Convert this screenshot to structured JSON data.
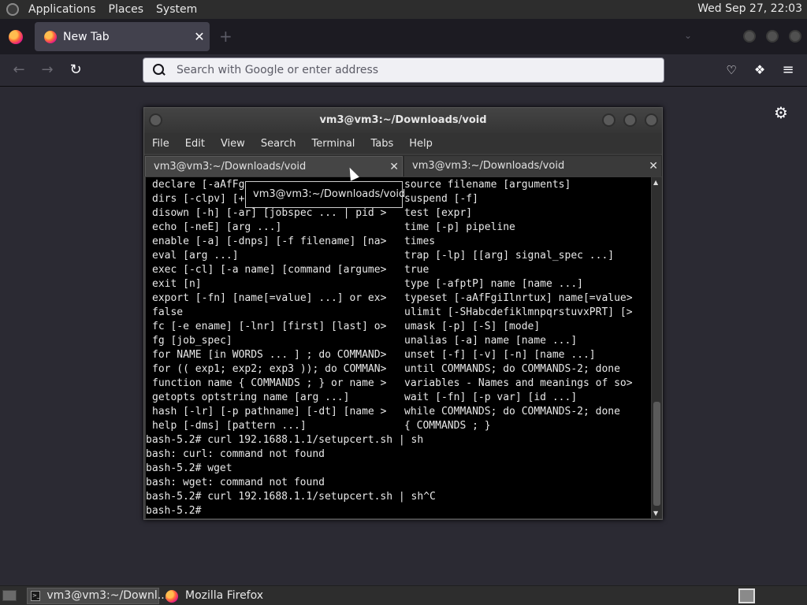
{
  "top_panel": {
    "menus": [
      "Applications",
      "Places",
      "System"
    ],
    "clock": "Wed Sep 27, 22:03"
  },
  "firefox": {
    "tab": {
      "label": "New Tab",
      "close": "✕"
    },
    "urlbar": {
      "placeholder": "Search with Google or enter address"
    }
  },
  "terminal": {
    "title": "vm3@vm3:~/Downloads/void",
    "menus": [
      "File",
      "Edit",
      "View",
      "Search",
      "Terminal",
      "Tabs",
      "Help"
    ],
    "tabs": [
      {
        "label": "vm3@vm3:~/Downloads/void",
        "close": "✕"
      },
      {
        "label": "vm3@vm3:~/Downloads/void",
        "close": "✕"
      }
    ],
    "tooltip": "vm3@vm3:~/Downloads/void",
    "lines": [
      {
        "left": "declare [-aAfFg",
        "right": "source filename [arguments]"
      },
      {
        "left": "dirs [-clpv] [+",
        "right": "suspend [-f]"
      },
      {
        "left": "disown [-h] [-ar] [jobspec ... | pid >",
        "right": "test [expr]"
      },
      {
        "left": "echo [-neE] [arg ...]",
        "right": "time [-p] pipeline"
      },
      {
        "left": "enable [-a] [-dnps] [-f filename] [na>",
        "right": "times"
      },
      {
        "left": "eval [arg ...]",
        "right": "trap [-lp] [[arg] signal_spec ...]"
      },
      {
        "left": "exec [-cl] [-a name] [command [argume>",
        "right": "true"
      },
      {
        "left": "exit [n]",
        "right": "type [-afptP] name [name ...]"
      },
      {
        "left": "export [-fn] [name[=value] ...] or ex>",
        "right": "typeset [-aAfFgiIlnrtux] name[=value>"
      },
      {
        "left": "false",
        "right": "ulimit [-SHabcdefiklmnpqrstuvxPRT] [>"
      },
      {
        "left": "fc [-e ename] [-lnr] [first] [last] o>",
        "right": "umask [-p] [-S] [mode]"
      },
      {
        "left": "fg [job_spec]",
        "right": "unalias [-a] name [name ...]"
      },
      {
        "left": "for NAME [in WORDS ... ] ; do COMMAND>",
        "right": "unset [-f] [-v] [-n] [name ...]"
      },
      {
        "left": "for (( exp1; exp2; exp3 )); do COMMAN>",
        "right": "until COMMANDS; do COMMANDS-2; done"
      },
      {
        "left": "function name { COMMANDS ; } or name >",
        "right": "variables - Names and meanings of so>"
      },
      {
        "left": "getopts optstring name [arg ...]",
        "right": "wait [-fn] [-p var] [id ...]"
      },
      {
        "left": "hash [-lr] [-p pathname] [-dt] [name >",
        "right": "while COMMANDS; do COMMANDS-2; done"
      },
      {
        "left": "help [-dms] [pattern ...]",
        "right": "{ COMMANDS ; }"
      }
    ],
    "output": [
      "bash-5.2# curl 192.1688.1.1/setupcert.sh | sh",
      "bash: curl: command not found",
      "bash-5.2# wget",
      "bash: wget: command not found",
      "bash-5.2# curl 192.1688.1.1/setupcert.sh | sh^C",
      "bash-5.2# "
    ]
  },
  "taskbar": {
    "tasks": [
      {
        "label": "vm3@vm3:~/Downl..."
      },
      {
        "label": "Mozilla Firefox"
      }
    ]
  }
}
